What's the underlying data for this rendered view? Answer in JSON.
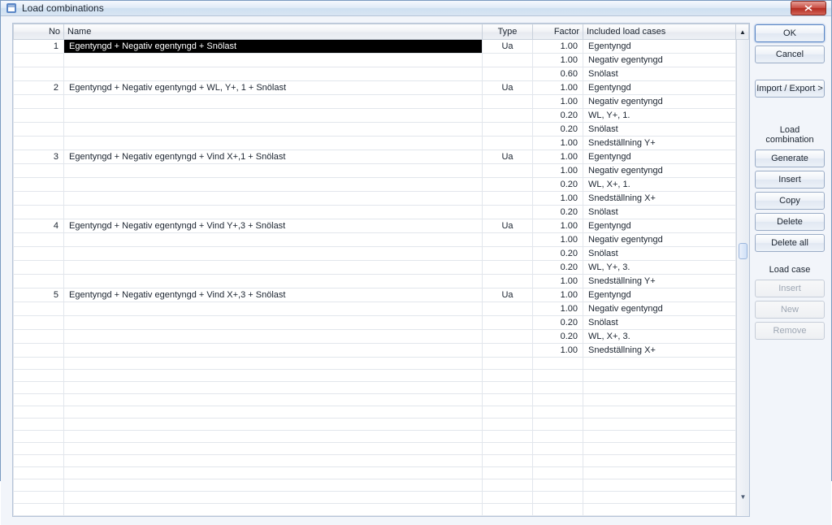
{
  "window": {
    "title": "Load combinations"
  },
  "buttons": {
    "ok": "OK",
    "cancel": "Cancel",
    "import_export": "Import / Export >",
    "section_combination": "Load combination",
    "generate": "Generate",
    "insert": "Insert",
    "copy": "Copy",
    "delete": "Delete",
    "delete_all": "Delete all",
    "section_case": "Load case",
    "case_insert": "Insert",
    "case_new": "New",
    "case_remove": "Remove"
  },
  "columns": {
    "no": "No",
    "name": "Name",
    "type": "Type",
    "factor": "Factor",
    "cases": "Included load cases"
  },
  "combos": [
    {
      "no": "1",
      "name": "Egentyngd + Negativ egentyngd + Snölast",
      "type": "Ua",
      "selected": true,
      "rows": [
        {
          "factor": "1.00",
          "case": "Egentyngd"
        },
        {
          "factor": "1.00",
          "case": "Negativ egentyngd"
        },
        {
          "factor": "0.60",
          "case": "Snölast"
        }
      ]
    },
    {
      "no": "2",
      "name": "Egentyngd + Negativ egentyngd + WL, Y+, 1 + Snölast",
      "type": "Ua",
      "rows": [
        {
          "factor": "1.00",
          "case": "Egentyngd"
        },
        {
          "factor": "1.00",
          "case": "Negativ egentyngd"
        },
        {
          "factor": "0.20",
          "case": "WL, Y+, 1."
        },
        {
          "factor": "0.20",
          "case": "Snölast"
        },
        {
          "factor": "1.00",
          "case": "Snedställning Y+"
        }
      ]
    },
    {
      "no": "3",
      "name": "Egentyngd + Negativ egentyngd + Vind X+,1 + Snölast",
      "type": "Ua",
      "rows": [
        {
          "factor": "1.00",
          "case": "Egentyngd"
        },
        {
          "factor": "1.00",
          "case": "Negativ egentyngd"
        },
        {
          "factor": "0.20",
          "case": "WL, X+, 1."
        },
        {
          "factor": "1.00",
          "case": "Snedställning X+"
        },
        {
          "factor": "0.20",
          "case": "Snölast"
        }
      ]
    },
    {
      "no": "4",
      "name": "Egentyngd + Negativ egentyngd + Vind Y+,3 + Snölast",
      "type": "Ua",
      "rows": [
        {
          "factor": "1.00",
          "case": "Egentyngd"
        },
        {
          "factor": "1.00",
          "case": "Negativ egentyngd"
        },
        {
          "factor": "0.20",
          "case": "Snölast"
        },
        {
          "factor": "0.20",
          "case": "WL, Y+, 3."
        },
        {
          "factor": "1.00",
          "case": "Snedställning Y+"
        }
      ]
    },
    {
      "no": "5",
      "name": "Egentyngd + Negativ egentyngd + Vind X+,3 + Snölast",
      "type": "Ua",
      "rows": [
        {
          "factor": "1.00",
          "case": "Egentyngd"
        },
        {
          "factor": "1.00",
          "case": "Negativ egentyngd"
        },
        {
          "factor": "0.20",
          "case": "Snölast"
        },
        {
          "factor": "0.20",
          "case": "WL, X+, 3."
        },
        {
          "factor": "1.00",
          "case": "Snedställning X+"
        }
      ]
    }
  ],
  "blank_rows": 13
}
